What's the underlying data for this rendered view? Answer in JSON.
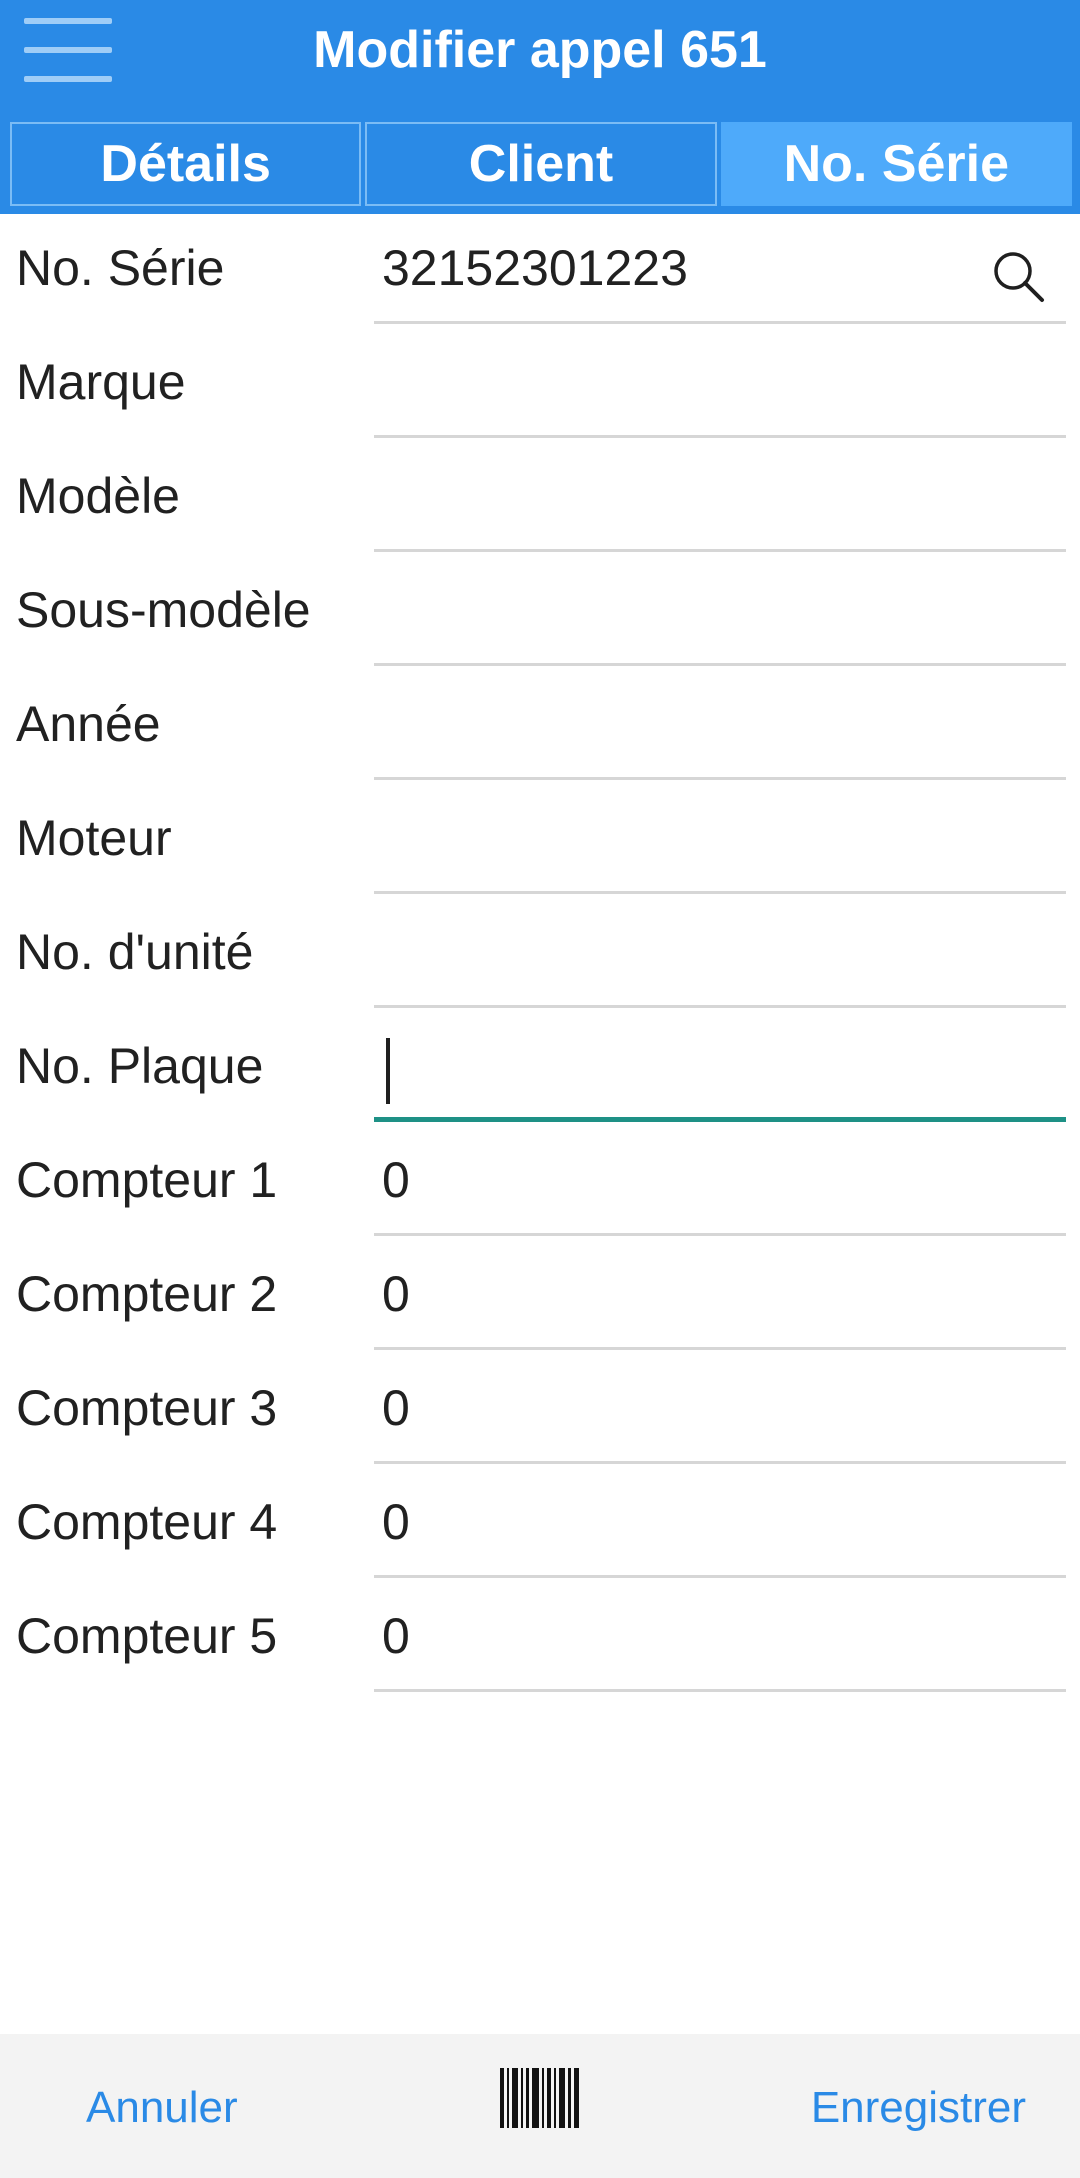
{
  "header": {
    "title": "Modifier appel 651",
    "menu_icon": "hamburger-menu-icon"
  },
  "tabs": [
    {
      "label": "Détails",
      "active": false
    },
    {
      "label": "Client",
      "active": false
    },
    {
      "label": "No. Série",
      "active": true
    }
  ],
  "form": {
    "serial": {
      "label": "No. Série",
      "value": "32152301223",
      "icon": "search-icon"
    },
    "brand": {
      "label": "Marque",
      "value": ""
    },
    "model": {
      "label": "Modèle",
      "value": ""
    },
    "submodel": {
      "label": "Sous-modèle",
      "value": ""
    },
    "year": {
      "label": "Année",
      "value": ""
    },
    "engine": {
      "label": "Moteur",
      "value": ""
    },
    "unit_no": {
      "label": "No. d'unité",
      "value": ""
    },
    "plate_no": {
      "label": "No. Plaque",
      "value": "",
      "focused": true
    },
    "counter1": {
      "label": "Compteur 1",
      "value": "0"
    },
    "counter2": {
      "label": "Compteur 2",
      "value": "0"
    },
    "counter3": {
      "label": "Compteur 3",
      "value": "0"
    },
    "counter4": {
      "label": "Compteur 4",
      "value": "0"
    },
    "counter5": {
      "label": "Compteur 5",
      "value": "0"
    }
  },
  "footer": {
    "cancel_label": "Annuler",
    "save_label": "Enregistrer",
    "scan_icon": "barcode-scan-icon"
  },
  "colors": {
    "header_bg": "#2a8ae6",
    "active_tab_bg": "#4eaafa",
    "focus_underline": "#1e9186",
    "link": "#2a8ae6",
    "footer_bg": "#f3f3f3"
  }
}
